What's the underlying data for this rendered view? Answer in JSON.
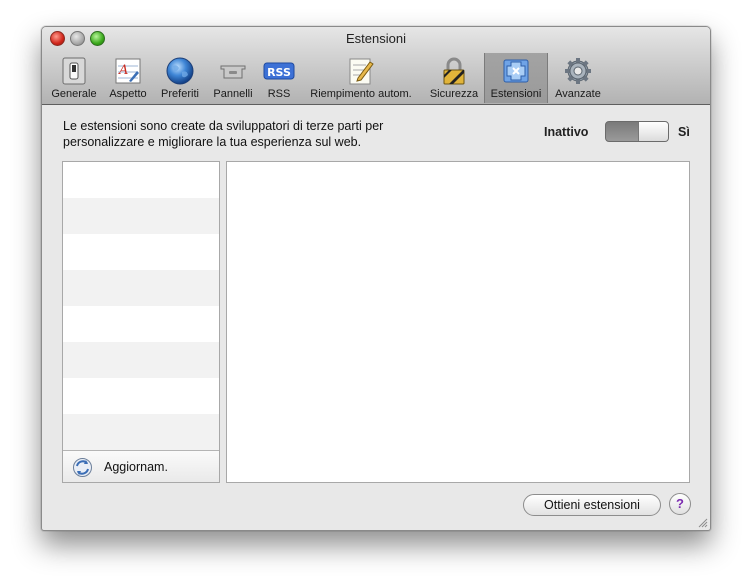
{
  "window": {
    "title": "Estensioni"
  },
  "toolbar": {
    "items": [
      {
        "label": "Generale",
        "icon": "switch-icon"
      },
      {
        "label": "Aspetto",
        "icon": "font-icon"
      },
      {
        "label": "Preferiti",
        "icon": "globe-icon"
      },
      {
        "label": "Pannelli",
        "icon": "tabs-icon"
      },
      {
        "label": "RSS",
        "icon": "rss-icon",
        "badge": "RSS"
      },
      {
        "label": "Riempimento autom.",
        "icon": "pencil-icon"
      },
      {
        "label": "Sicurezza",
        "icon": "lock-icon"
      },
      {
        "label": "Estensioni",
        "icon": "extensions-icon",
        "selected": true
      },
      {
        "label": "Avanzate",
        "icon": "gear-icon"
      }
    ]
  },
  "description": {
    "line1": "Le estensioni sono create da sviluppatori di terze parti per",
    "line2": "personalizzare e migliorare la tua esperienza sul web."
  },
  "toggle": {
    "off_label": "Inattivo",
    "on_label": "Sì",
    "state": "off"
  },
  "extensions_list": {
    "items": [],
    "update_label": "Aggiornam."
  },
  "buttons": {
    "get_extensions": "Ottieni estensioni",
    "help": "?"
  },
  "colors": {
    "accent": "#7b2bb0",
    "toolbar_selected": "#9f9f9f"
  }
}
